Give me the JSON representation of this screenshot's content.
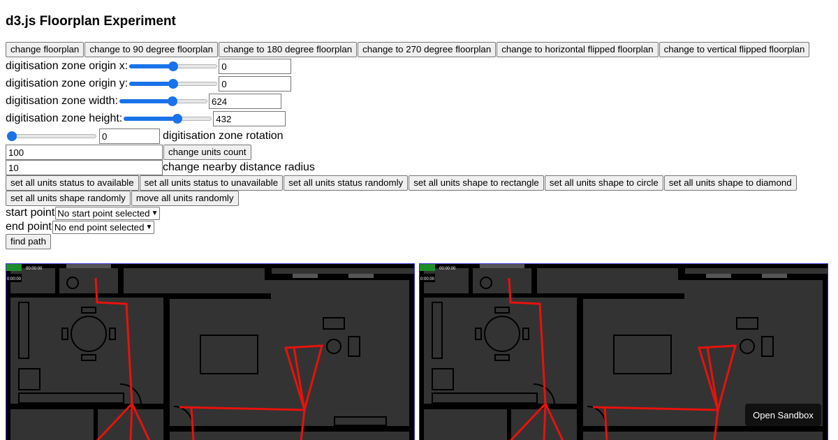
{
  "title": "d3.js Floorplan Experiment",
  "floorplan_buttons": [
    "change floorplan",
    "change to 90 degree floorplan",
    "change to 180 degree floorplan",
    "change to 270 degree floorplan",
    "change to horizontal flipped floorplan",
    "change to vertical flipped floorplan"
  ],
  "zone": {
    "origin_x": {
      "label": "digitisation zone origin x:",
      "value": "0",
      "slider_level": 0.5
    },
    "origin_y": {
      "label": "digitisation zone origin y:",
      "value": "0",
      "slider_level": 0.5
    },
    "width": {
      "label": "digitisation zone width:",
      "value": "624",
      "slider_level": 0.62
    },
    "height": {
      "label": "digitisation zone height:",
      "value": "432",
      "slider_level": 0.62
    },
    "rotation": {
      "label": "digitisation zone rotation",
      "value": "0",
      "slider_level": 0.0
    }
  },
  "units": {
    "count_value": "100",
    "count_button": "change units count",
    "radius_value": "10",
    "radius_label": "change nearby distance radius"
  },
  "unit_buttons": [
    "set all units status to available",
    "set all units status to unavailable",
    "set all units status randomly",
    "set all units shape to rectangle",
    "set all units shape to circle",
    "set all units shape to diamond",
    "set all units shape randomly",
    "move all units randomly"
  ],
  "path": {
    "start_label": "start point",
    "start_selected": "No start point selected",
    "end_label": "end point",
    "end_selected": "No end point selected",
    "find_button": "find path"
  },
  "panels": {
    "timestamp": "0:00:00",
    "timestamp_top": "00:00:00"
  },
  "sandbox_button": "Open Sandbox",
  "colors": {
    "accent": "#1a73e8",
    "path": "#e8120c",
    "floor": "#333333",
    "wall": "#000000",
    "border": "#3b2fd6"
  }
}
